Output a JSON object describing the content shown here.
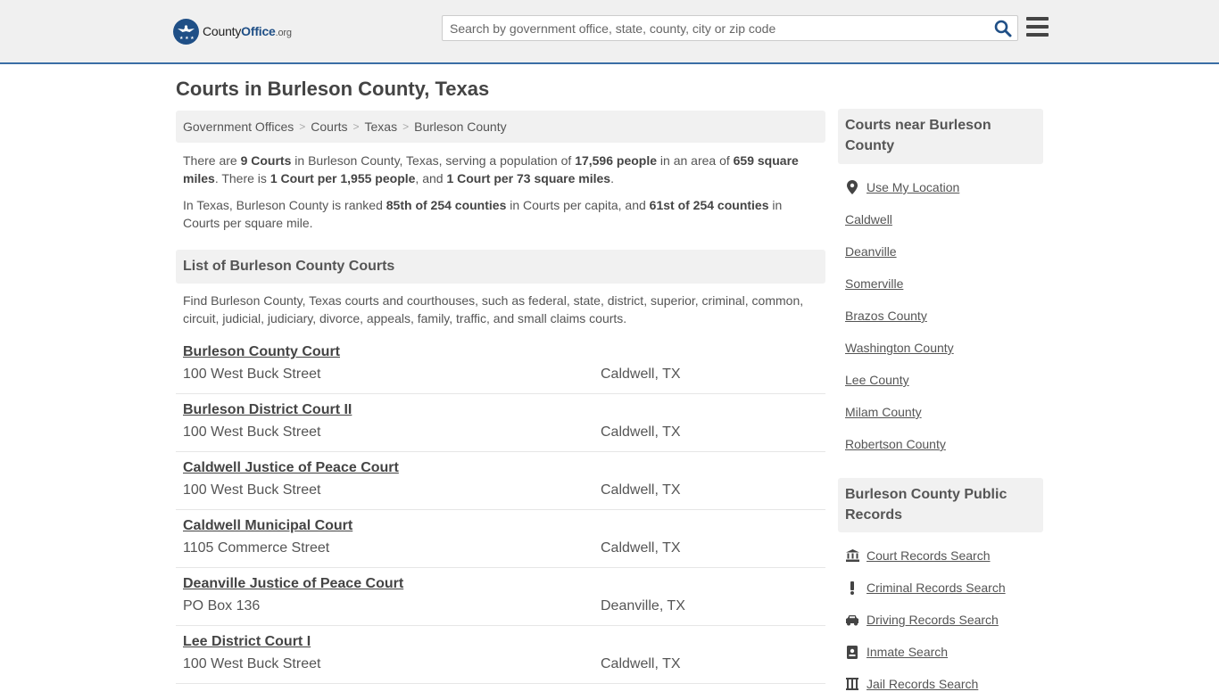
{
  "header": {
    "logo": {
      "brand_a": "County",
      "brand_b": "Office",
      "brand_c": ".org"
    },
    "search": {
      "placeholder": "Search by government office, state, county, city or zip code"
    }
  },
  "page": {
    "title": "Courts in Burleson County, Texas"
  },
  "breadcrumb": [
    "Government Offices",
    "Courts",
    "Texas",
    "Burleson County"
  ],
  "intro": {
    "p1": {
      "t1": "There are ",
      "b1": "9 Courts",
      "t2": " in Burleson County, Texas, serving a population of ",
      "b2": "17,596 people",
      "t3": " in an area of ",
      "b3": "659 square miles",
      "t4": ". There is ",
      "b4": "1 Court per 1,955 people",
      "t5": ", and ",
      "b5": "1 Court per 73 square miles",
      "t6": "."
    },
    "p2": {
      "t1": "In Texas, Burleson County is ranked ",
      "b1": "85th of 254 counties",
      "t2": " in Courts per capita, and ",
      "b2": "61st of 254 counties",
      "t3": " in Courts per square mile."
    }
  },
  "list": {
    "heading": "List of Burleson County Courts",
    "description": "Find Burleson County, Texas courts and courthouses, such as federal, state, district, superior, criminal, common, circuit, judicial, judiciary, divorce, appeals, family, traffic, and small claims courts.",
    "courts": [
      {
        "name": "Burleson County Court",
        "address": "100 West Buck Street",
        "city": "Caldwell, TX"
      },
      {
        "name": "Burleson District Court II",
        "address": "100 West Buck Street",
        "city": "Caldwell, TX"
      },
      {
        "name": "Caldwell Justice of Peace Court",
        "address": "100 West Buck Street",
        "city": "Caldwell, TX"
      },
      {
        "name": "Caldwell Municipal Court",
        "address": "1105 Commerce Street",
        "city": "Caldwell, TX"
      },
      {
        "name": "Deanville Justice of Peace Court",
        "address": "PO Box 136",
        "city": "Deanville, TX"
      },
      {
        "name": "Lee District Court I",
        "address": "100 West Buck Street",
        "city": "Caldwell, TX"
      }
    ]
  },
  "sidebar": {
    "nearby": {
      "heading": "Courts near Burleson County",
      "use_location": "Use My Location",
      "links": [
        "Caldwell",
        "Deanville",
        "Somerville",
        "Brazos County",
        "Washington County",
        "Lee County",
        "Milam County",
        "Robertson County"
      ]
    },
    "records": {
      "heading": "Burleson County Public Records",
      "links": [
        {
          "label": "Court Records Search",
          "icon": "courthouse-icon"
        },
        {
          "label": "Criminal Records Search",
          "icon": "exclamation-icon"
        },
        {
          "label": "Driving Records Search",
          "icon": "car-icon"
        },
        {
          "label": "Inmate Search",
          "icon": "id-badge-icon"
        },
        {
          "label": "Jail Records Search",
          "icon": "jail-icon"
        }
      ]
    }
  },
  "colors": {
    "accent": "#1f4f86",
    "header_border": "#3a6ea5",
    "header_bg": "#f0f0f0",
    "panel_bg": "#f1f1f1"
  }
}
